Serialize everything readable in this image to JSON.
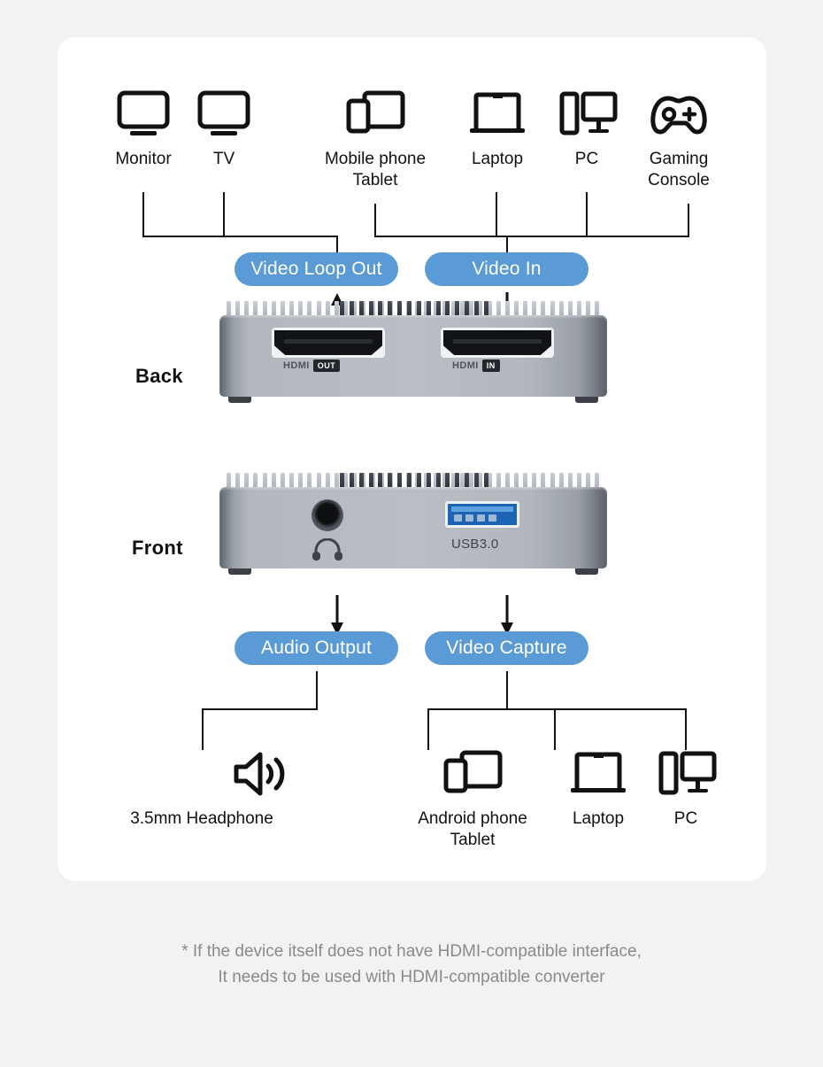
{
  "card": {
    "sources": {
      "loop_out_group": [
        {
          "label": "Monitor",
          "icon": "monitor-icon"
        },
        {
          "label": "TV",
          "icon": "tv-icon"
        }
      ],
      "video_in_group": [
        {
          "label": "Mobile phone\nTablet",
          "icon": "phone-tablet-icon"
        },
        {
          "label": "Laptop",
          "icon": "laptop-icon"
        },
        {
          "label": "PC",
          "icon": "pc-icon"
        },
        {
          "label": "Gaming\nConsole",
          "icon": "gamepad-icon"
        }
      ]
    },
    "pills": {
      "video_loop_out": "Video Loop Out",
      "video_in": "Video In",
      "audio_output": "Audio Output",
      "video_capture": "Video Capture"
    },
    "device_back": {
      "side_label": "Back",
      "ports": [
        {
          "name": "HDMI",
          "tag": "OUT"
        },
        {
          "name": "HDMI",
          "tag": "IN"
        }
      ]
    },
    "device_front": {
      "side_label": "Front",
      "audio_port_label": "",
      "usb_port_label": "USB3.0"
    },
    "outputs": {
      "audio_group": [
        {
          "label": "3.5mm Headphone",
          "icon": "speaker-icon"
        }
      ],
      "capture_group": [
        {
          "label": "Android phone\nTablet",
          "icon": "phone-tablet-icon"
        },
        {
          "label": "Laptop",
          "icon": "laptop-icon"
        },
        {
          "label": "PC",
          "icon": "pc-icon"
        }
      ]
    }
  },
  "footer": {
    "note": "* If the device itself does not have HDMI-compatible interface,\nIt needs to be used with HDMI-compatible converter"
  },
  "colors": {
    "accent_blue": "#5b9bd5",
    "page_background": "#f2f2f2",
    "card_background": "#ffffff",
    "line": "#111111",
    "footer_text": "#8a8a8a"
  }
}
